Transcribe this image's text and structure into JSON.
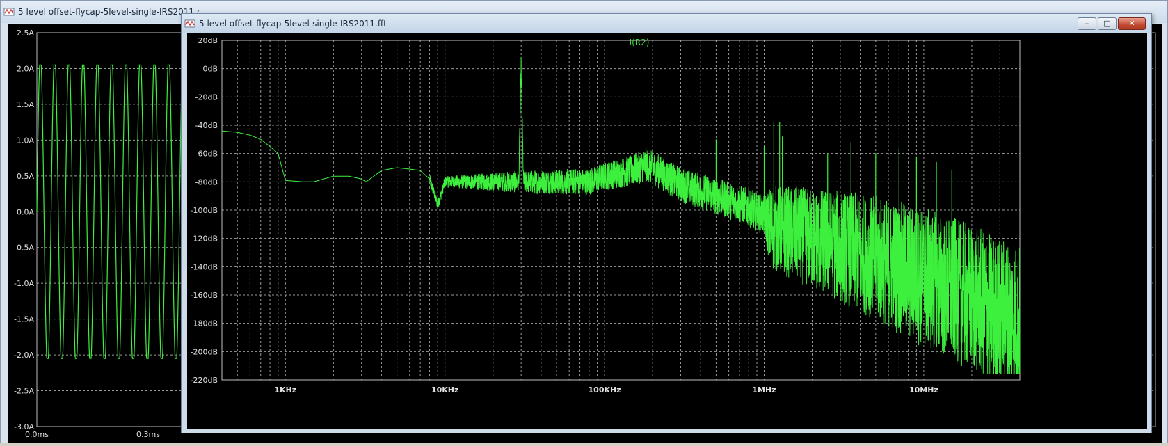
{
  "back_window": {
    "title": "5 level offset-flycap-5level-single-IRS2011.r",
    "y_ticks": [
      "2.5A",
      "2.0A",
      "1.5A",
      "1.0A",
      "0.5A",
      "0.0A",
      "-0.5A",
      "-1.0A",
      "-1.5A",
      "-2.0A",
      "-2.5A",
      "-3.0A"
    ],
    "x_ticks": [
      "0.0ms",
      "0.3ms"
    ],
    "trace_color": "#3df03d"
  },
  "front_window": {
    "title": "5 level offset-flycap-5level-single-IRS2011.fft",
    "buttons": {
      "minimize": "–",
      "maximize": "□",
      "close": "✕"
    }
  },
  "chart_data": {
    "type": "line",
    "title": "I(R2)",
    "xlabel": "",
    "ylabel": "",
    "x_scale": "log",
    "x_range_hz": [
      400,
      40000000
    ],
    "ylim": [
      -220,
      20
    ],
    "y_ticks": [
      "20dB",
      "0dB",
      "-20dB",
      "-40dB",
      "-60dB",
      "-80dB",
      "-100dB",
      "-120dB",
      "-140dB",
      "-160dB",
      "-180dB",
      "-200dB",
      "-220dB"
    ],
    "x_ticks": [
      {
        "value": 1000,
        "label": "1KHz"
      },
      {
        "value": 10000,
        "label": "10KHz"
      },
      {
        "value": 100000,
        "label": "100KHz"
      },
      {
        "value": 1000000,
        "label": "1MHz"
      },
      {
        "value": 10000000,
        "label": "10MHz"
      }
    ],
    "grid": true,
    "trace_color": "#3df03d",
    "title_color": "#33dd33",
    "series": [
      {
        "name": "I(R2)",
        "envelope": [
          [
            400,
            -44
          ],
          [
            500,
            -45
          ],
          [
            600,
            -47
          ],
          [
            700,
            -50
          ],
          [
            800,
            -55
          ],
          [
            900,
            -60
          ],
          [
            1000,
            -79
          ],
          [
            1300,
            -80
          ],
          [
            1500,
            -80
          ],
          [
            2000,
            -76
          ],
          [
            2500,
            -76
          ],
          [
            3000,
            -78
          ],
          [
            3200,
            -80
          ],
          [
            4000,
            -72
          ],
          [
            5000,
            -70
          ],
          [
            6000,
            -71
          ],
          [
            7000,
            -72
          ],
          [
            8000,
            -78
          ],
          [
            9000,
            -96
          ],
          [
            10000,
            -80
          ],
          [
            15000,
            -80
          ],
          [
            20000,
            -80
          ],
          [
            29000,
            -80
          ],
          [
            30000,
            1
          ],
          [
            31000,
            -80
          ],
          [
            50000,
            -80
          ],
          [
            80000,
            -80
          ],
          [
            100000,
            -76
          ],
          [
            150000,
            -72
          ],
          [
            180000,
            -68
          ],
          [
            200000,
            -70
          ],
          [
            300000,
            -82
          ],
          [
            500000,
            -90
          ],
          [
            800000,
            -98
          ],
          [
            1000000,
            -104
          ],
          [
            1100000,
            -112
          ],
          [
            2000000,
            -120
          ],
          [
            3000000,
            -126
          ],
          [
            5000000,
            -134
          ],
          [
            10000000,
            -148
          ],
          [
            20000000,
            -162
          ],
          [
            30000000,
            -172
          ],
          [
            40000000,
            -178
          ]
        ],
        "spread_db": [
          [
            400,
            0
          ],
          [
            10000,
            4
          ],
          [
            30000,
            8
          ],
          [
            100000,
            10
          ],
          [
            200000,
            12
          ],
          [
            1000000,
            14
          ],
          [
            1100000,
            30
          ],
          [
            3000000,
            40
          ],
          [
            10000000,
            50
          ],
          [
            40000000,
            54
          ]
        ],
        "spikes": [
          [
            500000,
            -50
          ],
          [
            1000000,
            -55
          ],
          [
            1150000,
            -38
          ],
          [
            1250000,
            -38
          ],
          [
            1300000,
            -48
          ],
          [
            2500000,
            -60
          ],
          [
            3500000,
            -52
          ],
          [
            5000000,
            -60
          ],
          [
            7000000,
            -56
          ],
          [
            9000000,
            -62
          ],
          [
            12000000,
            -66
          ],
          [
            15000000,
            -72
          ]
        ]
      }
    ]
  }
}
